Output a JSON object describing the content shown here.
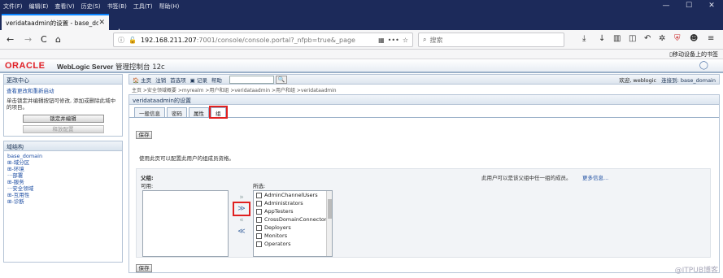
{
  "menubar": {
    "items": [
      "文件(F)",
      "编辑(E)",
      "查看(V)",
      "历史(S)",
      "书签(B)",
      "工具(T)",
      "帮助(H)"
    ],
    "win_controls": [
      "—",
      "☐",
      "✕"
    ]
  },
  "tabstrip": {
    "tab_title": "veridataadmin的设置 - base_do",
    "close": "✕",
    "new_tab": "+"
  },
  "navbar": {
    "back": "←",
    "forward": "→",
    "reload": "C",
    "home": "⌂",
    "url_host": "192.168.211.207",
    "url_path": ":7001/console/console.portal?_nfpb=true&_page",
    "page_actions": "•••",
    "bookmark_star": "☆",
    "search_placeholder": "搜索"
  },
  "bookmarks": {
    "mobile": "移动设备上的书签"
  },
  "header": {
    "oracle": "ORACLE",
    "product": "WebLogic Server",
    "subtitle": "管理控制台 12c"
  },
  "change_center": {
    "title": "更改中心",
    "view_link": "查看更改和重新启动",
    "text": "单击锁定并编辑按钮可修改, 添加或删除此域中的项目。",
    "lock_button": "锁定并编辑",
    "release_button": "释放配置"
  },
  "domain_structure": {
    "title": "域结构",
    "items": [
      "base_domain",
      "⊞-域分区",
      "⊞-环境",
      "···部署",
      "⊞-服务",
      "···安全领域",
      "⊞-互用性",
      "⊞-诊断"
    ]
  },
  "toolbar": {
    "home": "主页",
    "logout": "注销",
    "prefs": "首选项",
    "record": "记录",
    "help": "帮助",
    "search_btn": "🔍",
    "welcome": "欢迎, weblogic",
    "connected": "连接到: base_domain"
  },
  "breadcrumb": "主页 >安全领域概要 >myrealm >用户和组 >veridataadmin >用户和组 >veridataadmin",
  "panel": {
    "title": "veridataadmin的设置",
    "tabs": [
      "一般信息",
      "密码",
      "属性",
      "组"
    ],
    "active_tab": 3,
    "save_label": "保存",
    "description": "使用此页可以配置此用户的组成员资格。",
    "parent_label": "父组:",
    "available_label": "可用:",
    "chosen_label": "所选:",
    "note": "此用户可以是该父组中任一组的成员。",
    "more_info": "更多信息...",
    "arrows": [
      "»",
      "≫",
      "«",
      "≪"
    ],
    "chosen_items": [
      "AdminChannelUsers",
      "Administrators",
      "AppTesters",
      "CrossDomainConnectors",
      "Deployers",
      "Monitors",
      "Operators"
    ]
  },
  "watermark": "@ITPUB博客"
}
